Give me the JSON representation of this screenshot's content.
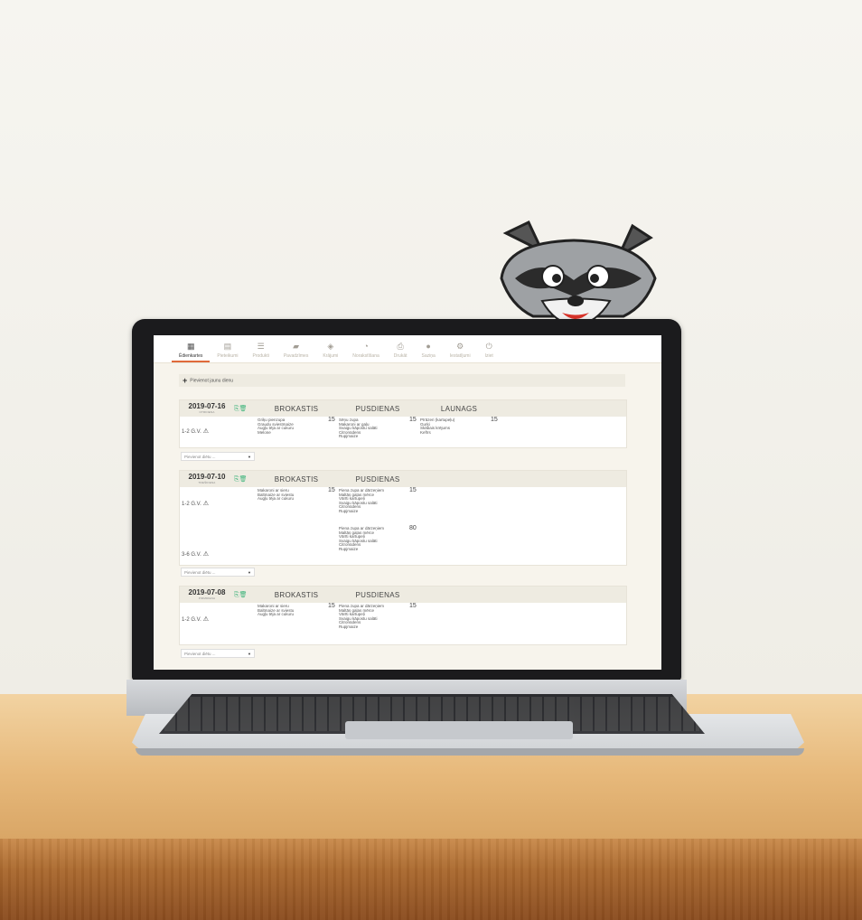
{
  "toolbar": {
    "items": [
      {
        "label": "Ēdienkartes",
        "icon": "calendar-icon",
        "active": true
      },
      {
        "label": "Pieteikumi",
        "icon": "document-icon"
      },
      {
        "label": "Produkti",
        "icon": "list-icon"
      },
      {
        "label": "Pavadzīmes",
        "icon": "truck-icon"
      },
      {
        "label": "Krājumi",
        "icon": "tag-icon"
      },
      {
        "label": "Norakstīšana",
        "icon": "gauge-icon"
      },
      {
        "label": "Drukāt",
        "icon": "printer-icon"
      },
      {
        "label": "Saziņa",
        "icon": "chat-icon"
      },
      {
        "label": "Iestatījumi",
        "icon": "gear-icon"
      },
      {
        "label": "Iziet",
        "icon": "power-icon"
      }
    ]
  },
  "add_day_label": "Pievienot jaunu dienu",
  "select_placeholder": "Pievienot diētu ...",
  "days": [
    {
      "date": "2019-07-16",
      "weekday": "OTRDIENA",
      "meals": [
        "BROKASTIS",
        "PUSDIENAS",
        "LAUNAGS"
      ],
      "rows": [
        {
          "group": "1-2 G.V.",
          "cells": [
            {
              "items": [
                "Griķu pienzupa",
                "Graudu sviestmaize",
                "Augļu tēja ar cukuru",
                "Melone"
              ],
              "qty": "15"
            },
            {
              "items": [
                "Sēņu zupa",
                "Makaroni ar gaļu",
                "Svaigu kāpostu salāti",
                "Citronūdens",
                "Rupjmaize"
              ],
              "qty": "15"
            },
            {
              "items": [
                "Pīrāzeri (kartupeļu)",
                "Gurķi",
                "Skābais krējums",
                "Kefīrs"
              ],
              "qty": "15"
            }
          ]
        }
      ]
    },
    {
      "date": "2019-07-10",
      "weekday": "TREŠDIENA",
      "meals": [
        "BROKASTIS",
        "PUSDIENAS"
      ],
      "rows": [
        {
          "group": "1-2 G.V.",
          "cells": [
            {
              "items": [
                "Makaroni ar sieru",
                "Baltmaize ar sviestu",
                "Augļu tēja ar cukuru"
              ],
              "qty": "15"
            },
            {
              "items": [
                "Piena zupa ar dārzeņiem",
                "Maltās gaļas mērce",
                "Vārīti kartupeļi",
                "Svaigu kāpostu salāti",
                "Citronūdens",
                "Rupjmaize"
              ],
              "qty": "15"
            }
          ]
        },
        {
          "group": "3-6 G.V.",
          "cells": [
            {
              "items": [],
              "qty": ""
            },
            {
              "items": [
                "Piena zupa ar dārzeņiem",
                "Maltās gaļas mērce",
                "Vārīti kartupeļi",
                "Svaigu kāpostu salāti",
                "Citronūdens",
                "Rupjmaize"
              ],
              "qty": "80"
            }
          ]
        }
      ]
    },
    {
      "date": "2019-07-08",
      "weekday": "PIRMDIENA",
      "meals": [
        "BROKASTIS",
        "PUSDIENAS"
      ],
      "rows": [
        {
          "group": "1-2 G.V.",
          "cells": [
            {
              "items": [
                "Makaroni ar sieru",
                "Baltmaize ar sviestu",
                "Augļu tēja ar cukuru"
              ],
              "qty": "15"
            },
            {
              "items": [
                "Piena zupa ar dārzeņiem",
                "Maltās gaļas mērce",
                "Vārīti kartupeļi",
                "Svaigu kāpostu salāti",
                "Citronūdens",
                "Rupjmaize"
              ],
              "qty": "15"
            }
          ]
        }
      ]
    }
  ],
  "colors": {
    "accent": "#e06a3a",
    "action_icons": "#3cb37a",
    "header_bg": "#eeebe1"
  }
}
